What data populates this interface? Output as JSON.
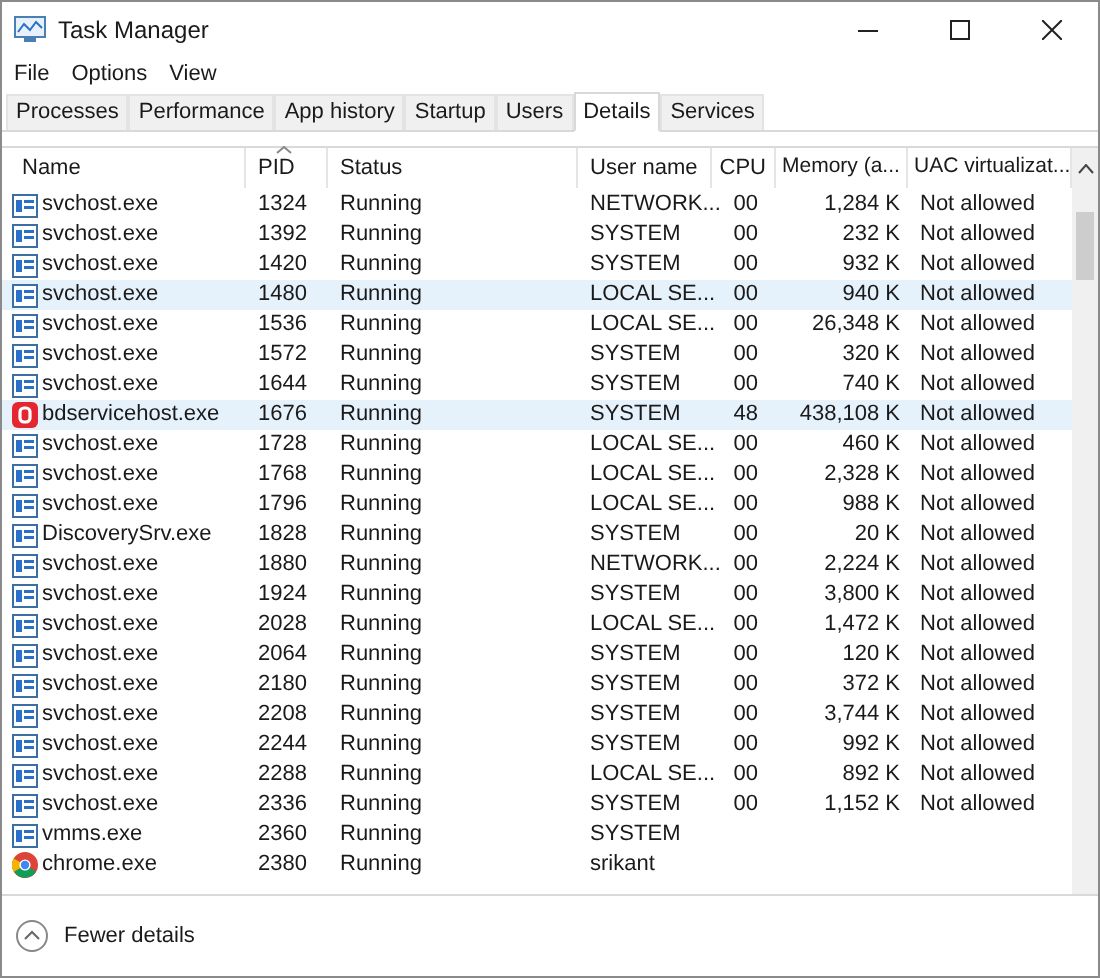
{
  "window": {
    "title": "Task Manager"
  },
  "menu": [
    "File",
    "Options",
    "View"
  ],
  "tabs": [
    {
      "label": "Processes",
      "selected": false
    },
    {
      "label": "Performance",
      "selected": false
    },
    {
      "label": "App history",
      "selected": false
    },
    {
      "label": "Startup",
      "selected": false
    },
    {
      "label": "Users",
      "selected": false
    },
    {
      "label": "Details",
      "selected": true
    },
    {
      "label": "Services",
      "selected": false
    }
  ],
  "table": {
    "columns": [
      "Name",
      "PID",
      "Status",
      "User name",
      "CPU",
      "Memory (a...",
      "UAC virtualizat..."
    ],
    "rows": [
      {
        "kind": "service",
        "name": "svchost.exe",
        "pid": "1324",
        "status": "Running",
        "user": "NETWORK...",
        "cpu": "00",
        "memory": "1,284 K",
        "uac": "Not allowed",
        "selected": false
      },
      {
        "kind": "service",
        "name": "svchost.exe",
        "pid": "1392",
        "status": "Running",
        "user": "SYSTEM",
        "cpu": "00",
        "memory": "232 K",
        "uac": "Not allowed",
        "selected": false
      },
      {
        "kind": "service",
        "name": "svchost.exe",
        "pid": "1420",
        "status": "Running",
        "user": "SYSTEM",
        "cpu": "00",
        "memory": "932 K",
        "uac": "Not allowed",
        "selected": false
      },
      {
        "kind": "service",
        "name": "svchost.exe",
        "pid": "1480",
        "status": "Running",
        "user": "LOCAL SE...",
        "cpu": "00",
        "memory": "940 K",
        "uac": "Not allowed",
        "selected": true
      },
      {
        "kind": "service",
        "name": "svchost.exe",
        "pid": "1536",
        "status": "Running",
        "user": "LOCAL SE...",
        "cpu": "00",
        "memory": "26,348 K",
        "uac": "Not allowed",
        "selected": false
      },
      {
        "kind": "service",
        "name": "svchost.exe",
        "pid": "1572",
        "status": "Running",
        "user": "SYSTEM",
        "cpu": "00",
        "memory": "320 K",
        "uac": "Not allowed",
        "selected": false
      },
      {
        "kind": "service",
        "name": "svchost.exe",
        "pid": "1644",
        "status": "Running",
        "user": "SYSTEM",
        "cpu": "00",
        "memory": "740 K",
        "uac": "Not allowed",
        "selected": false
      },
      {
        "kind": "shield",
        "name": "bdservicehost.exe",
        "pid": "1676",
        "status": "Running",
        "user": "SYSTEM",
        "cpu": "48",
        "memory": "438,108 K",
        "uac": "Not allowed",
        "selected": true
      },
      {
        "kind": "service",
        "name": "svchost.exe",
        "pid": "1728",
        "status": "Running",
        "user": "LOCAL SE...",
        "cpu": "00",
        "memory": "460 K",
        "uac": "Not allowed",
        "selected": false
      },
      {
        "kind": "service",
        "name": "svchost.exe",
        "pid": "1768",
        "status": "Running",
        "user": "LOCAL SE...",
        "cpu": "00",
        "memory": "2,328 K",
        "uac": "Not allowed",
        "selected": false
      },
      {
        "kind": "service",
        "name": "svchost.exe",
        "pid": "1796",
        "status": "Running",
        "user": "LOCAL SE...",
        "cpu": "00",
        "memory": "988 K",
        "uac": "Not allowed",
        "selected": false
      },
      {
        "kind": "service",
        "name": "DiscoverySrv.exe",
        "pid": "1828",
        "status": "Running",
        "user": "SYSTEM",
        "cpu": "00",
        "memory": "20 K",
        "uac": "Not allowed",
        "selected": false
      },
      {
        "kind": "service",
        "name": "svchost.exe",
        "pid": "1880",
        "status": "Running",
        "user": "NETWORK...",
        "cpu": "00",
        "memory": "2,224 K",
        "uac": "Not allowed",
        "selected": false
      },
      {
        "kind": "service",
        "name": "svchost.exe",
        "pid": "1924",
        "status": "Running",
        "user": "SYSTEM",
        "cpu": "00",
        "memory": "3,800 K",
        "uac": "Not allowed",
        "selected": false
      },
      {
        "kind": "service",
        "name": "svchost.exe",
        "pid": "2028",
        "status": "Running",
        "user": "LOCAL SE...",
        "cpu": "00",
        "memory": "1,472 K",
        "uac": "Not allowed",
        "selected": false
      },
      {
        "kind": "service",
        "name": "svchost.exe",
        "pid": "2064",
        "status": "Running",
        "user": "SYSTEM",
        "cpu": "00",
        "memory": "120 K",
        "uac": "Not allowed",
        "selected": false
      },
      {
        "kind": "service",
        "name": "svchost.exe",
        "pid": "2180",
        "status": "Running",
        "user": "SYSTEM",
        "cpu": "00",
        "memory": "372 K",
        "uac": "Not allowed",
        "selected": false
      },
      {
        "kind": "service",
        "name": "svchost.exe",
        "pid": "2208",
        "status": "Running",
        "user": "SYSTEM",
        "cpu": "00",
        "memory": "3,744 K",
        "uac": "Not allowed",
        "selected": false
      },
      {
        "kind": "service",
        "name": "svchost.exe",
        "pid": "2244",
        "status": "Running",
        "user": "SYSTEM",
        "cpu": "00",
        "memory": "992 K",
        "uac": "Not allowed",
        "selected": false
      },
      {
        "kind": "service",
        "name": "svchost.exe",
        "pid": "2288",
        "status": "Running",
        "user": "LOCAL SE...",
        "cpu": "00",
        "memory": "892 K",
        "uac": "Not allowed",
        "selected": false
      },
      {
        "kind": "service",
        "name": "svchost.exe",
        "pid": "2336",
        "status": "Running",
        "user": "SYSTEM",
        "cpu": "00",
        "memory": "1,152 K",
        "uac": "Not allowed",
        "selected": false
      },
      {
        "kind": "service",
        "name": "vmms.exe",
        "pid": "2360",
        "status": "Running",
        "user": "SYSTEM",
        "selected": false
      },
      {
        "kind": "browser",
        "name": "chrome.exe",
        "pid": "2380",
        "status": "Running",
        "user": "srikant",
        "selected": false
      }
    ]
  },
  "footer": {
    "label": "Fewer details"
  }
}
